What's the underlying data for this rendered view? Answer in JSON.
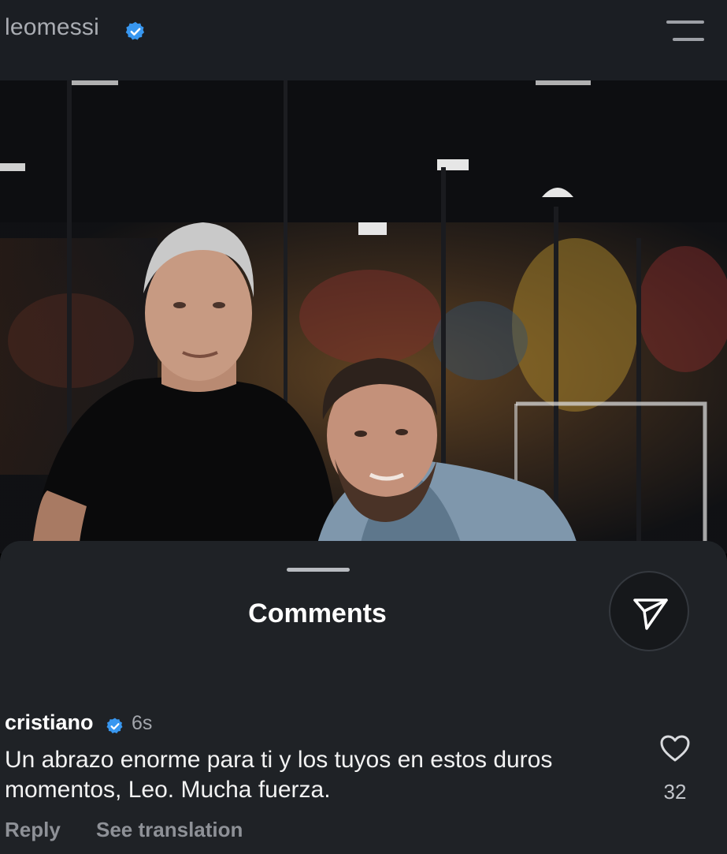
{
  "header": {
    "username": "leomessi",
    "verified_icon": "verified-badge-icon",
    "menu_icon": "hamburger-menu-icon"
  },
  "post": {
    "image_alt": "Photo of two men posing together in an indoor football venue"
  },
  "comments_sheet": {
    "title": "Comments",
    "share_icon": "paper-plane-icon"
  },
  "comment": {
    "username": "cristiano",
    "time": "6s",
    "text": "Un abrazo enorme para ti y los tuyos en estos duros momentos, Leo. Mucha fuerza.",
    "reply_label": "Reply",
    "translate_label": "See translation",
    "like_icon": "heart-outline-icon",
    "like_count": "32"
  },
  "colors": {
    "accent_verified": "#3897f0",
    "sheet_background": "#1f2226",
    "topbar_background": "#1b1e23"
  }
}
